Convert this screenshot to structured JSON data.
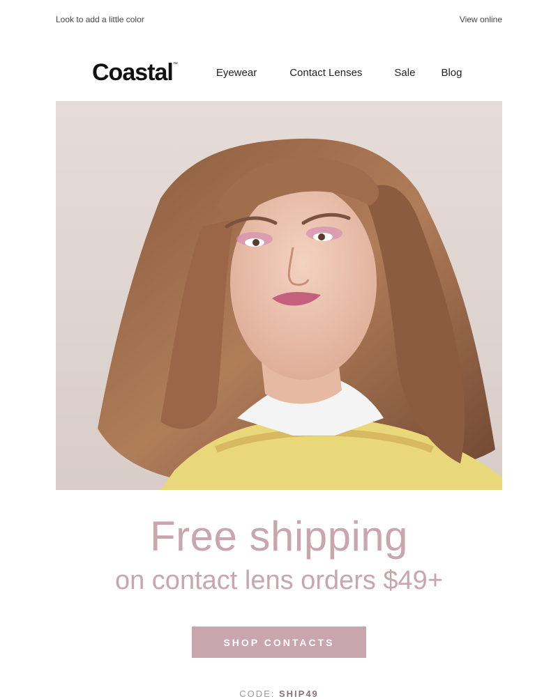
{
  "preheader": {
    "left_text": "Look to add a little color",
    "right_link": "View online"
  },
  "header": {
    "logo": "Coastal",
    "logo_tm": "™",
    "nav": [
      "Eyewear",
      "Contact Lenses",
      "Sale",
      "Blog"
    ]
  },
  "hero": {
    "image_alt": "Woman with long wavy brown hair, pink eye makeup, yellow knit sweater over white collar"
  },
  "promo": {
    "headline": "Free shipping",
    "subhead": "on contact lens orders $49+",
    "cta_label": "SHOP CONTACTS",
    "code_label": "CODE:",
    "code_value": "SHIP49"
  },
  "colors": {
    "accent": "#c9a6ae",
    "hero_bg": "#e1d8d4"
  }
}
